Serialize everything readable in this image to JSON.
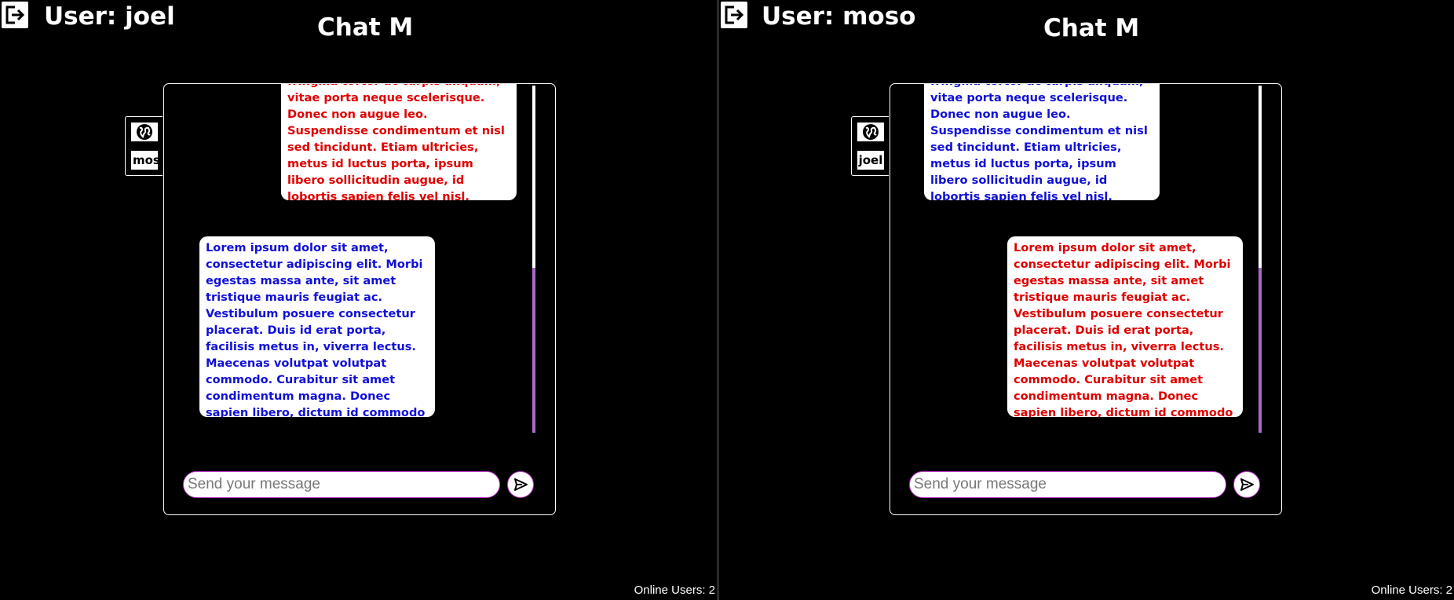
{
  "app_title": "Chat M",
  "colors": {
    "own_message": "#e00000",
    "other_message": "#1010d8",
    "input_border": "#c43ed0",
    "scroll_thumb": "#a86cc6"
  },
  "icons": {
    "logout": "logout-icon",
    "public_chat": "globe-icon",
    "send": "send-icon"
  },
  "left": {
    "user_label": "User: joel",
    "contact_name": "moso",
    "message_top_text": "fringilla tortor ac turpis aliquam, vitae porta neque scelerisque. Donec non augue leo. Suspendisse condimentum et nisl sed tincidunt. Etiam ultricies, metus id luctus porta, ipsum libero sollicitudin augue, id lobortis sapien felis vel nisl. Integer vitae erat quis odio rhoncus porta id quis odio.",
    "message_bottom_text": "Lorem ipsum dolor sit amet, consectetur adipiscing elit. Morbi egestas massa ante, sit amet tristique mauris feugiat ac. Vestibulum posuere consectetur placerat. Duis id erat porta, facilisis metus in, viverra lectus. Maecenas volutpat volutpat commodo. Curabitur sit amet condimentum magna. Donec sapien libero, dictum id commodo ac, pulvinar quis felis.",
    "input_placeholder": "Send your message",
    "online_users": "Online Users: 2"
  },
  "right": {
    "user_label": "User: moso",
    "contact_name": "joel",
    "message_top_text": "fringilla tortor ac turpis aliquam, vitae porta neque scelerisque. Donec non augue leo. Suspendisse condimentum et nisl sed tincidunt. Etiam ultricies, metus id luctus porta, ipsum libero sollicitudin augue, id lobortis sapien felis vel nisl. Integer vitae erat quis odio rhoncus porta id quis odio.",
    "message_bottom_text": "Lorem ipsum dolor sit amet, consectetur adipiscing elit. Morbi egestas massa ante, sit amet tristique mauris feugiat ac. Vestibulum posuere consectetur placerat. Duis id erat porta, facilisis metus in, viverra lectus. Maecenas volutpat volutpat commodo. Curabitur sit amet condimentum magna. Donec sapien libero, dictum id commodo ac, pulvinar quis felis.",
    "input_placeholder": "Send your message",
    "online_users": "Online Users: 2"
  }
}
